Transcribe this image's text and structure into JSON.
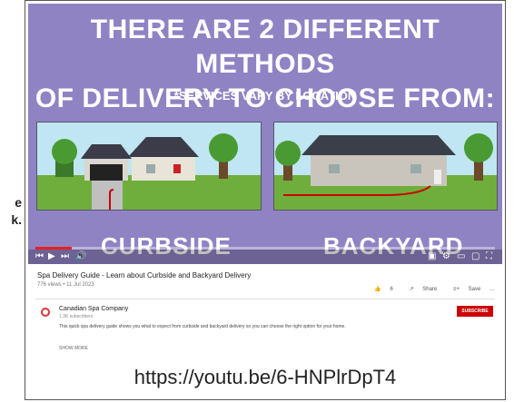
{
  "side_text": {
    "line1": "e",
    "line2": "k."
  },
  "video": {
    "title_line1": "THERE ARE 2 DIFFERENT METHODS",
    "title_line2": "OF DELIVERY TO CHOOSE FROM:",
    "subtitle": "*SERVICES VARY BY LOCATION",
    "left_label": "CURBSIDE",
    "right_label": "BACKYARD",
    "progress": 0.08
  },
  "below": {
    "video_title": "Spa Delivery Guide - Learn about Curbside and Backyard Delivery",
    "meta": "776 views • 11 Jul 2023",
    "actions": [
      "6",
      "Share",
      "Save"
    ],
    "channel": "Canadian Spa Company",
    "subs": "1.3K subscribers",
    "subscribe_label": "SUBSCRIBE",
    "description": "This quick spa delivery guide shows you what to expect from curbside and backyard delivery so you can choose the right option for your home.",
    "more_label": "SHOW MORE"
  },
  "url": "https://youtu.be/6-HNPlrDpT4",
  "colors": {
    "background": "#9083c4",
    "accent": "#e52020"
  }
}
